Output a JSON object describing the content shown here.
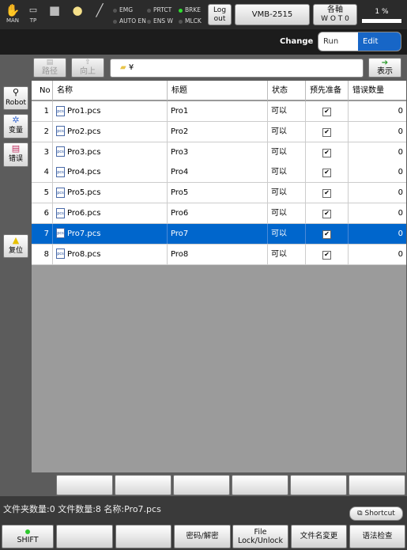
{
  "topbar": {
    "man_label": "MAN",
    "tp_label": "TP",
    "emg": "EMG",
    "auto_en": "AUTO EN",
    "prtct": "PRTCT",
    "ensw": "ENS W",
    "brke": "BRKE",
    "mlck": "MLCK",
    "logout": "Log\nout",
    "robot_model": "VMB-2515",
    "axis_top": "各軸",
    "axis_bottom": "W O T 0",
    "speed": "1 %"
  },
  "changebar": {
    "label": "Change",
    "run": "Run",
    "edit": "Edit",
    "accent": "#1766c7"
  },
  "nav": {
    "path_btn": "路径",
    "up_btn": "向上",
    "path_value": "¥",
    "show_btn": "表示"
  },
  "side": {
    "robot": "Robot",
    "variable": "变量",
    "error": "错误",
    "reset": "复位"
  },
  "table": {
    "columns": [
      "No",
      "名称",
      "标题",
      "状态",
      "预先准备",
      "错误数量"
    ],
    "rows": [
      {
        "no": "1",
        "name": "Pro1.pcs",
        "title": "Pro1",
        "status": "可以",
        "prep": "✔",
        "errors": "0"
      },
      {
        "no": "2",
        "name": "Pro2.pcs",
        "title": "Pro2",
        "status": "可以",
        "prep": "✔",
        "errors": "0"
      },
      {
        "no": "3",
        "name": "Pro3.pcs",
        "title": "Pro3",
        "status": "可以",
        "prep": "✔",
        "errors": "0"
      },
      {
        "no": "4",
        "name": "Pro4.pcs",
        "title": "Pro4",
        "status": "可以",
        "prep": "✔",
        "errors": "0"
      },
      {
        "no": "5",
        "name": "Pro5.pcs",
        "title": "Pro5",
        "status": "可以",
        "prep": "✔",
        "errors": "0"
      },
      {
        "no": "6",
        "name": "Pro6.pcs",
        "title": "Pro6",
        "status": "可以",
        "prep": "✔",
        "errors": "0"
      },
      {
        "no": "7",
        "name": "Pro7.pcs",
        "title": "Pro7",
        "status": "可以",
        "prep": "✔",
        "errors": "0"
      },
      {
        "no": "8",
        "name": "Pro8.pcs",
        "title": "Pro8",
        "status": "可以",
        "prep": "✔",
        "errors": "0"
      }
    ],
    "selected_color": "#0066cc"
  },
  "status": {
    "text": "文件夹数量:0  文件数量:8  名称:Pro7.pcs",
    "shortcut": "Shortcut"
  },
  "bottom": {
    "shift": "SHIFT",
    "encrypt": "密码/解密",
    "file_lock": "File\nLock/Unlock",
    "rename": "文件名変更",
    "syntax": "语法检查"
  }
}
